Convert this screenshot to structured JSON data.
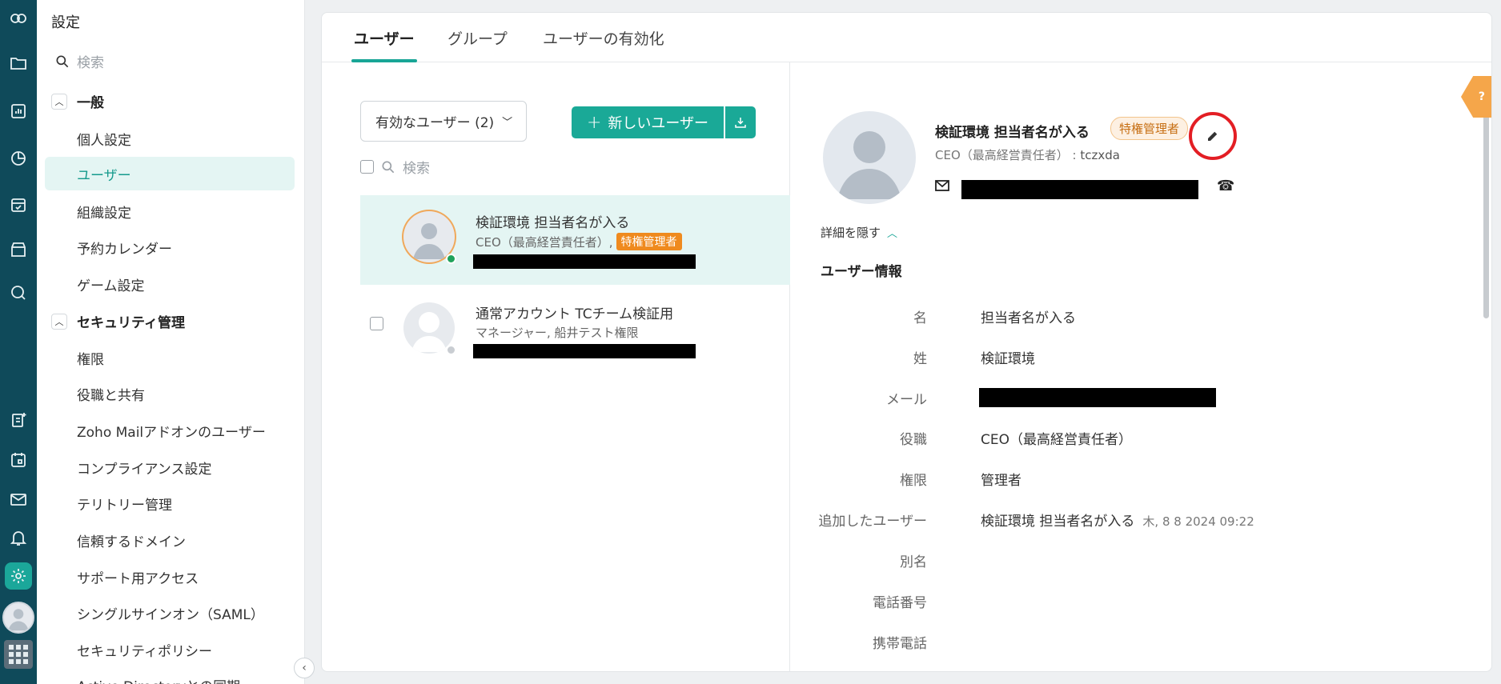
{
  "sidebar": {
    "title": "設定",
    "search_placeholder": "検索",
    "sections": [
      {
        "label": "一般",
        "items": [
          "個人設定",
          "ユーザー",
          "組織設定",
          "予約カレンダー",
          "ゲーム設定"
        ]
      },
      {
        "label": "セキュリティ管理",
        "items": [
          "権限",
          "役職と共有",
          "Zoho Mailアドオンのユーザー",
          "コンプライアンス設定",
          "テリトリー管理",
          "信頼するドメイン",
          "サポート用アクセス",
          "シングルサインオン（SAML）",
          "セキュリティポリシー",
          "Active Directoryとの同期"
        ]
      }
    ],
    "active_item": "ユーザー"
  },
  "tabs": [
    "ユーザー",
    "グループ",
    "ユーザーの有効化"
  ],
  "list": {
    "filter_label": "有効なユーザー (2)",
    "new_user_label": "新しいユーザー",
    "search_placeholder": "検索",
    "users": [
      {
        "name": "検証環境 担当者名が入る",
        "subtitle": "CEO（最高経営責任者）,",
        "badge": "特権管理者",
        "status": "online"
      },
      {
        "name": "通常アカウント TCチーム検証用",
        "subtitle": "マネージャー, 船井テスト権限",
        "badge": "",
        "status": "offline"
      }
    ]
  },
  "detail": {
    "name": "検証環境 担当者名が入る",
    "badge": "特権管理者",
    "role_line": "CEO（最高経営責任者）",
    "role_sep": " : ",
    "role_code": "tczxda",
    "toggle_label": "詳細を隠す",
    "section_title": "ユーザー情報",
    "fields": [
      {
        "label": "名",
        "value": "担当者名が入る"
      },
      {
        "label": "姓",
        "value": "検証環境"
      },
      {
        "label": "メール",
        "value": ""
      },
      {
        "label": "役職",
        "value": "CEO（最高経営責任者）"
      },
      {
        "label": "権限",
        "value": "管理者"
      },
      {
        "label": "追加したユーザー",
        "value": "検証環境 担当者名が入る",
        "extra": "木, 8 8 2024 09:22"
      },
      {
        "label": "別名",
        "value": ""
      },
      {
        "label": "電話番号",
        "value": ""
      },
      {
        "label": "携帯電話",
        "value": ""
      }
    ]
  },
  "help_label": "?",
  "colors": {
    "accent": "#1aa997",
    "rail": "#0f4a5a",
    "badge": "#ef8a1e",
    "highlight_ring": "#e31e24"
  }
}
